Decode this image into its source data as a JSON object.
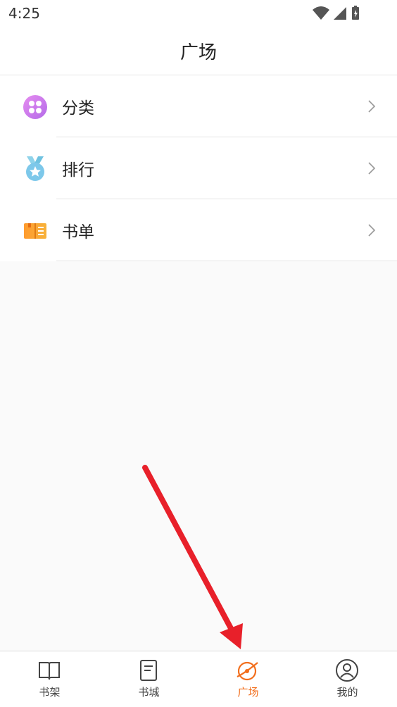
{
  "status": {
    "time": "4:25"
  },
  "header": {
    "title": "广场"
  },
  "menu": {
    "items": [
      {
        "label": "分类",
        "icon": "category-icon"
      },
      {
        "label": "排行",
        "icon": "medal-icon"
      },
      {
        "label": "书单",
        "icon": "book-list-icon"
      }
    ]
  },
  "tabs": [
    {
      "label": "书架",
      "icon": "open-book-icon"
    },
    {
      "label": "书城",
      "icon": "document-icon"
    },
    {
      "label": "广场",
      "icon": "planet-icon",
      "active": true
    },
    {
      "label": "我的",
      "icon": "profile-icon"
    }
  ],
  "colors": {
    "accent": "#f26e1c",
    "annotation_arrow": "#e8202a"
  }
}
